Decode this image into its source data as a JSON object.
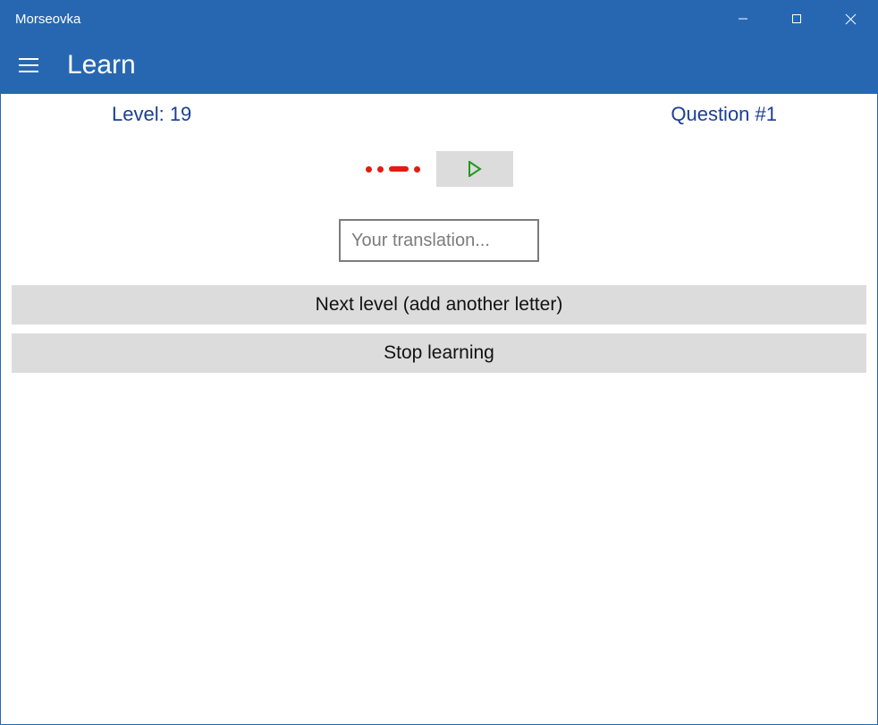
{
  "window": {
    "title": "Morseovka"
  },
  "header": {
    "page_title": "Learn"
  },
  "content": {
    "level_label": "Level: 19",
    "question_label": "Question #1",
    "morse_symbols": [
      "dot",
      "dot",
      "dash",
      "dot"
    ],
    "input_placeholder": "Your translation...",
    "next_level_label": "Next level (add another letter)",
    "stop_learning_label": "Stop learning"
  }
}
